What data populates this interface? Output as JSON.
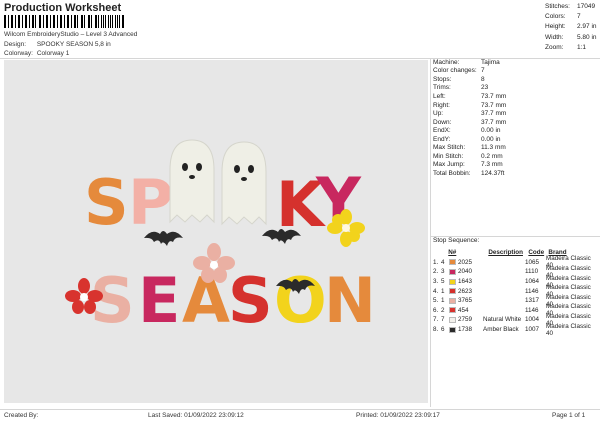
{
  "header": {
    "title": "Production Worksheet",
    "software": "Wilcom EmbroideryStudio – Level 3 Advanced",
    "design_label": "Design:",
    "design_value": "SPOOKY SEASON 5,8 in",
    "colorway_label": "Colorway:",
    "colorway_value": "Colorway 1"
  },
  "stats": [
    {
      "k": "Stitches:",
      "v": "17049"
    },
    {
      "k": "Colors:",
      "v": "7"
    },
    {
      "k": "Height:",
      "v": "2.97 in"
    },
    {
      "k": "Width:",
      "v": "5.80 in"
    },
    {
      "k": "Zoom:",
      "v": "1:1"
    }
  ],
  "info": [
    {
      "k": "Machine:",
      "v": "Tajima"
    },
    {
      "k": "Color changes:",
      "v": "7"
    },
    {
      "k": "Stops:",
      "v": "8"
    },
    {
      "k": "Trims:",
      "v": "23"
    },
    {
      "k": "Left:",
      "v": "73.7 mm"
    },
    {
      "k": "Right:",
      "v": "73.7 mm"
    },
    {
      "k": "Up:",
      "v": "37.7 mm"
    },
    {
      "k": "Down:",
      "v": "37.7 mm"
    },
    {
      "k": "EndX:",
      "v": "0.00 in"
    },
    {
      "k": "EndY:",
      "v": "0.00 in"
    },
    {
      "k": "Max Stitch:",
      "v": "11.3 mm"
    },
    {
      "k": "Min Stitch:",
      "v": "0.2 mm"
    },
    {
      "k": "Max Jump:",
      "v": "7.3 mm"
    },
    {
      "k": "Total Bobbin:",
      "v": "124.37ft"
    }
  ],
  "stop_sequence_label": "Stop Sequence:",
  "stop_columns": [
    "N#",
    "Description",
    "Code",
    "Brand"
  ],
  "stops": [
    {
      "stop": "1.",
      "n": "4",
      "color": "#e58a3c",
      "code_no": "2025",
      "desc": "",
      "code": "1065",
      "brand": "Madeira Classic 40"
    },
    {
      "stop": "2.",
      "n": "3",
      "color": "#c8285f",
      "code_no": "2040",
      "desc": "",
      "code": "1110",
      "brand": "Madeira Classic 40"
    },
    {
      "stop": "3.",
      "n": "5",
      "color": "#f2d31c",
      "code_no": "1643",
      "desc": "",
      "code": "1064",
      "brand": "Madeira Classic 40"
    },
    {
      "stop": "4.",
      "n": "1",
      "color": "#d5312d",
      "code_no": "2623",
      "desc": "",
      "code": "1146",
      "brand": "Madeira Classic 40"
    },
    {
      "stop": "5.",
      "n": "1",
      "color": "#eab0a3",
      "code_no": "3765",
      "desc": "",
      "code": "1317",
      "brand": "Madeira Classic 40"
    },
    {
      "stop": "6.",
      "n": "2",
      "color": "#d8332e",
      "code_no": "454",
      "desc": "",
      "code": "1146",
      "brand": "Madeira Classic 40"
    },
    {
      "stop": "7.",
      "n": "7",
      "color": "#f3f1ec",
      "code_no": "2759",
      "desc": "Natural White",
      "code": "1004",
      "brand": "Madeira Classic 40"
    },
    {
      "stop": "8.",
      "n": "6",
      "color": "#2b2b2b",
      "code_no": "1738",
      "desc": "Amber Black",
      "code": "1007",
      "brand": "Madeira Classic 40"
    }
  ],
  "footer": {
    "created_by": "Created By:",
    "last_saved": "Last Saved: 01/09/2022 23:09:12",
    "printed": "Printed: 01/09/2022 23:09:17",
    "page": "Page 1 of 1"
  },
  "design_text": {
    "line1": [
      "S",
      "P",
      "K",
      "Y"
    ],
    "line2": [
      "S",
      "E",
      "A",
      "S",
      "O",
      "N"
    ]
  }
}
